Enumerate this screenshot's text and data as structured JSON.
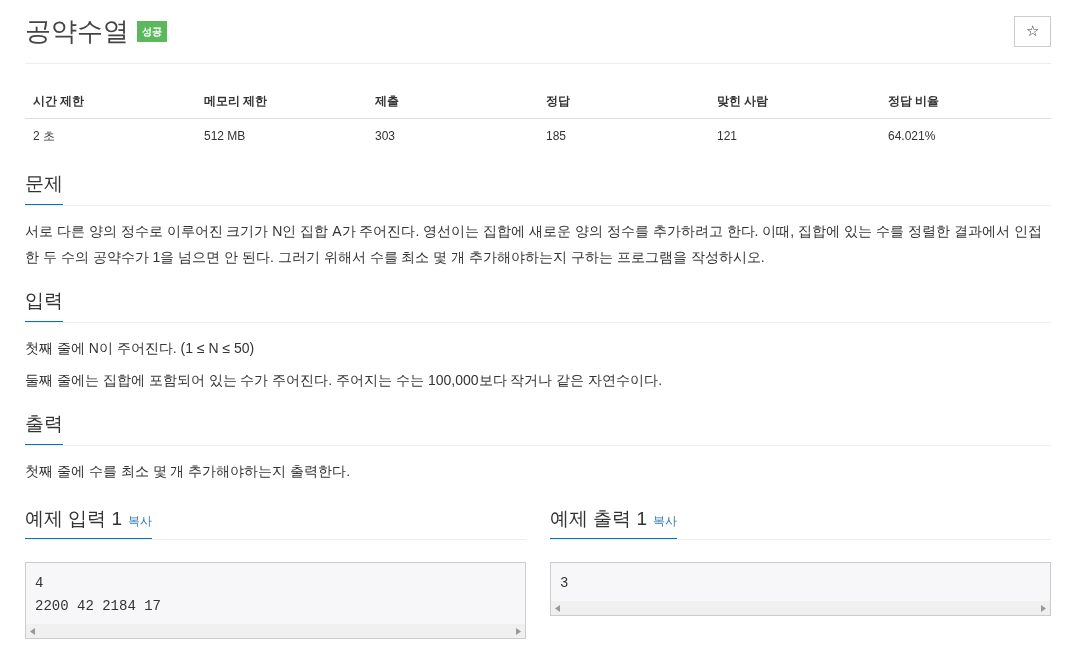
{
  "title": "공약수열",
  "result_badge": "성공",
  "star_button": "☆",
  "info_table": {
    "columns": [
      "시간 제한",
      "메모리 제한",
      "제출",
      "정답",
      "맞힌 사람",
      "정답 비율"
    ],
    "rows": [
      [
        "2 초",
        "512 MB",
        "303",
        "185",
        "121",
        "64.021%"
      ]
    ]
  },
  "sections": [
    {
      "heading": "문제",
      "paragraphs": [
        "서로 다른 양의 정수로 이루어진 크기가 N인 집합 A가 주어진다. 영선이는 집합에 새로운 양의 정수를 추가하려고 한다. 이때, 집합에 있는 수를 정렬한 결과에서 인접한 두 수의 공약수가 1을 넘으면 안 된다. 그러기 위해서 수를 최소 몇 개 추가해야하는지 구하는 프로그램을 작성하시오."
      ]
    },
    {
      "heading": "입력",
      "paragraphs": [
        "첫째 줄에 N이 주어진다. (1 ≤ N ≤ 50)",
        "둘째 줄에는 집합에 포함되어 있는 수가 주어진다. 주어지는 수는 100,000보다 작거나 같은 자연수이다."
      ]
    },
    {
      "heading": "출력",
      "paragraphs": [
        "첫째 줄에 수를 최소 몇 개 추가해야하는지 출력한다."
      ]
    }
  ],
  "samples": [
    {
      "heading": "예제 입력 1",
      "copy_link": "복사",
      "lines": [
        "4",
        "2200 42 2184 17"
      ]
    },
    {
      "heading": "예제 출력 1",
      "copy_link": "복사",
      "lines": [
        "3"
      ]
    }
  ]
}
